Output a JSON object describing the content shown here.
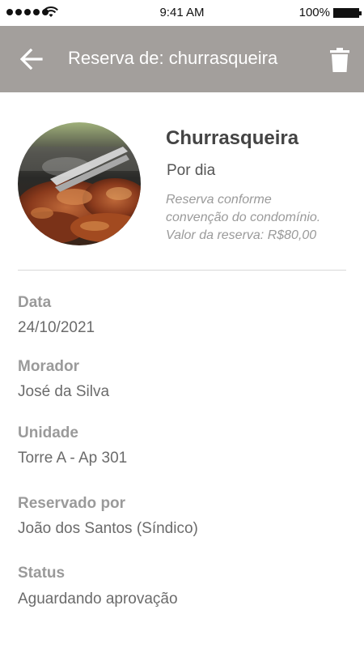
{
  "status_bar": {
    "time": "9:41 AM",
    "battery": "100%"
  },
  "app_bar": {
    "title": "Reserva de: churrasqueira",
    "back_icon": "arrow-left-icon",
    "delete_icon": "trash-icon",
    "background_color": "#a39f9c"
  },
  "amenity": {
    "name": "Churrasqueira",
    "period": "Por dia",
    "description_lines": [
      "Reserva conforme",
      "convenção do condomínio.",
      "Valor da reserva: R$80,00"
    ]
  },
  "fields": [
    {
      "label": "Data",
      "value": "24/10/2021"
    },
    {
      "label": "Morador",
      "value": "José da Silva"
    },
    {
      "label": "Unidade",
      "value": "Torre A - Ap 301"
    },
    {
      "label": "Reservado por",
      "value": "João dos Santos (Síndico)"
    },
    {
      "label": "Status",
      "value": "Aguardando aprovação"
    }
  ]
}
